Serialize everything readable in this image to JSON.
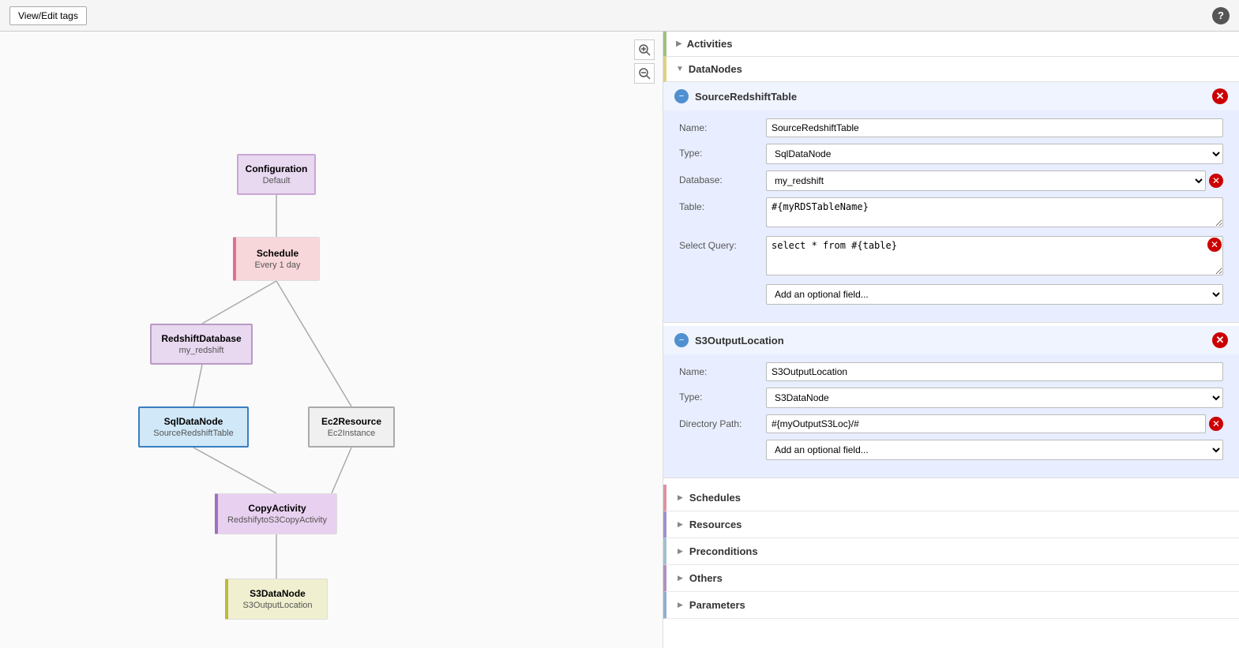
{
  "topbar": {
    "view_edit_btn": "View/Edit tags",
    "help_icon": "?"
  },
  "diagram": {
    "nodes": {
      "config": {
        "title": "Configuration",
        "sub": "Default"
      },
      "schedule": {
        "title": "Schedule",
        "sub": "Every 1 day"
      },
      "redshift_db": {
        "title": "RedshiftDatabase",
        "sub": "my_redshift"
      },
      "sql_node": {
        "title": "SqlDataNode",
        "sub": "SourceRedshiftTable"
      },
      "ec2": {
        "title": "Ec2Resource",
        "sub": "Ec2Instance"
      },
      "copy": {
        "title": "CopyActivity",
        "sub": "RedshifytoS3CopyActivity"
      },
      "s3": {
        "title": "S3DataNode",
        "sub": "S3OutputLocation"
      }
    }
  },
  "right_panel": {
    "activities": {
      "label": "Activities",
      "expanded": false
    },
    "datanodes": {
      "label": "DataNodes",
      "expanded": true,
      "nodes": [
        {
          "id": "source-redshift",
          "name": "SourceRedshiftTable",
          "fields": {
            "name": {
              "label": "Name:",
              "value": "SourceRedshiftTable",
              "type": "input"
            },
            "type": {
              "label": "Type:",
              "value": "SqlDataNode",
              "type": "select",
              "options": [
                "SqlDataNode"
              ]
            },
            "database": {
              "label": "Database:",
              "value": "my_redshift",
              "type": "select-clearable",
              "options": [
                "my_redshift"
              ]
            },
            "table": {
              "label": "Table:",
              "value": "#{myRDSTableName}",
              "type": "textarea-small"
            },
            "select_query": {
              "label": "Select Query:",
              "value": "select * from #{table}",
              "type": "textarea"
            },
            "optional": {
              "label": "",
              "value": "Add an optional field...",
              "type": "select-optional"
            }
          }
        },
        {
          "id": "s3-output",
          "name": "S3OutputLocation",
          "fields": {
            "name": {
              "label": "Name:",
              "value": "S3OutputLocation",
              "type": "input"
            },
            "type": {
              "label": "Type:",
              "value": "S3DataNode",
              "type": "select",
              "options": [
                "S3DataNode"
              ]
            },
            "directory_path": {
              "label": "Directory Path:",
              "value": "#{myOutputS3Loc}/#",
              "type": "input-clearable"
            },
            "optional": {
              "label": "",
              "value": "Add an optional field...",
              "type": "select-optional"
            }
          }
        }
      ]
    },
    "schedules": {
      "label": "Schedules"
    },
    "resources": {
      "label": "Resources"
    },
    "preconditions": {
      "label": "Preconditions"
    },
    "others": {
      "label": "Others"
    },
    "parameters": {
      "label": "Parameters"
    }
  },
  "zoom": {
    "in": "⊕",
    "out": "⊖"
  },
  "section_accents": {
    "activities": "#a0c080",
    "datanodes": "#e0d080",
    "schedules": "#e090a0",
    "resources": "#a090d0",
    "preconditions": "#a0c0d0",
    "others": "#b090c0",
    "parameters": "#90b0d0"
  }
}
